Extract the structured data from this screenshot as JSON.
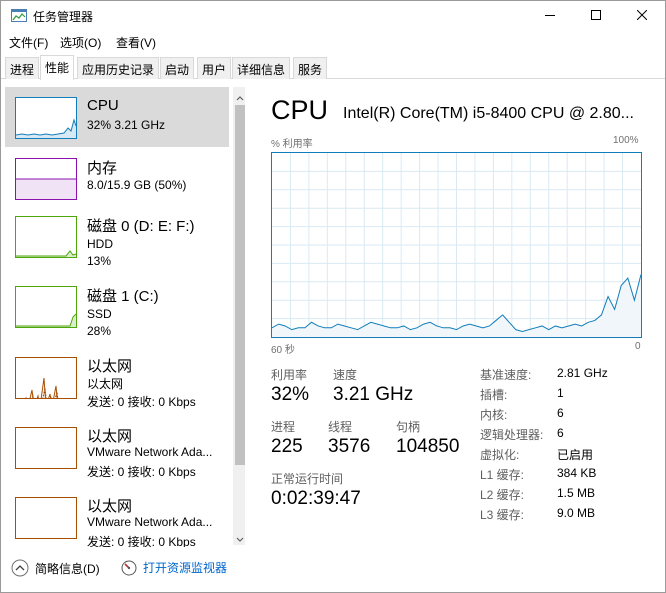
{
  "window": {
    "title": "任务管理器",
    "controls": {
      "minimize": "minimize-icon",
      "maximize": "maximize-icon",
      "close": "close-icon"
    }
  },
  "menu": [
    "文件(F)",
    "选项(O)",
    "查看(V)"
  ],
  "tabs": [
    "进程",
    "性能",
    "应用历史记录",
    "启动",
    "用户",
    "详细信息",
    "服务"
  ],
  "active_tab": "性能",
  "sidebar": {
    "items": [
      {
        "title": "CPU",
        "line1": "32% 3.21 GHz",
        "line2": "",
        "color": "#117dbb"
      },
      {
        "title": "内存",
        "line1": "8.0/15.9 GB (50%)",
        "line2": "",
        "color": "#8b12ae"
      },
      {
        "title": "磁盘 0 (D: E: F:)",
        "line1": "HDD",
        "line2": "13%",
        "color": "#4da60c"
      },
      {
        "title": "磁盘 1 (C:)",
        "line1": "SSD",
        "line2": "28%",
        "color": "#4da60c"
      },
      {
        "title": "以太网",
        "line1": "以太网",
        "line2": "发送: 0 接收: 0 Kbps",
        "color": "#a74f01"
      },
      {
        "title": "以太网",
        "line1": "VMware Network Ada...",
        "line2": "发送: 0 接收: 0 Kbps",
        "color": "#a74f01"
      },
      {
        "title": "以太网",
        "line1": "VMware Network Ada...",
        "line2": "发送: 0 接收: 0 Kbps",
        "color": "#a74f01"
      }
    ]
  },
  "detail": {
    "heading": "CPU",
    "model": "Intel(R) Core(TM) i5-8400 CPU @ 2.80...",
    "graph_label_left": "% 利用率",
    "graph_label_right": "100%",
    "graph_bottom_left": "60 秒",
    "graph_bottom_right": "0",
    "stats": {
      "utilization_label": "利用率",
      "utilization_value": "32%",
      "speed_label": "速度",
      "speed_value": "3.21 GHz",
      "processes_label": "进程",
      "processes_value": "225",
      "threads_label": "线程",
      "threads_value": "3576",
      "handles_label": "句柄",
      "handles_value": "104850",
      "uptime_label": "正常运行时间",
      "uptime_value": "0:02:39:47"
    },
    "specs": [
      {
        "label": "基准速度:",
        "value": "2.81 GHz"
      },
      {
        "label": "插槽:",
        "value": "1"
      },
      {
        "label": "内核:",
        "value": "6"
      },
      {
        "label": "逻辑处理器:",
        "value": "6"
      },
      {
        "label": "虚拟化:",
        "value": "已启用"
      },
      {
        "label": "L1 缓存:",
        "value": "384 KB"
      },
      {
        "label": "L2 缓存:",
        "value": "1.5 MB"
      },
      {
        "label": "L3 缓存:",
        "value": "9.0 MB"
      }
    ]
  },
  "footer": {
    "summary": "简略信息(D)",
    "resource_monitor": "打开资源监视器"
  },
  "colors": {
    "cpu": "#117dbb",
    "memory": "#8b12ae",
    "disk": "#4da60c",
    "ethernet": "#a74f01",
    "link": "#0066cc",
    "selected_bg": "#dadada"
  },
  "chart_data": {
    "type": "area",
    "x_range": [
      60,
      0
    ],
    "ylim": [
      0,
      100
    ],
    "grid": true,
    "values": [
      5,
      7,
      6,
      4,
      5,
      5,
      8,
      6,
      5,
      5,
      7,
      6,
      5,
      4,
      6,
      8,
      7,
      6,
      5,
      5,
      6,
      4,
      5,
      7,
      8,
      6,
      5,
      5,
      4,
      6,
      7,
      6,
      5,
      6,
      9,
      12,
      8,
      4,
      3,
      4,
      5,
      6,
      4,
      6,
      5,
      6,
      7,
      6,
      8,
      9,
      12,
      22,
      15,
      28,
      32,
      20,
      34
    ]
  }
}
